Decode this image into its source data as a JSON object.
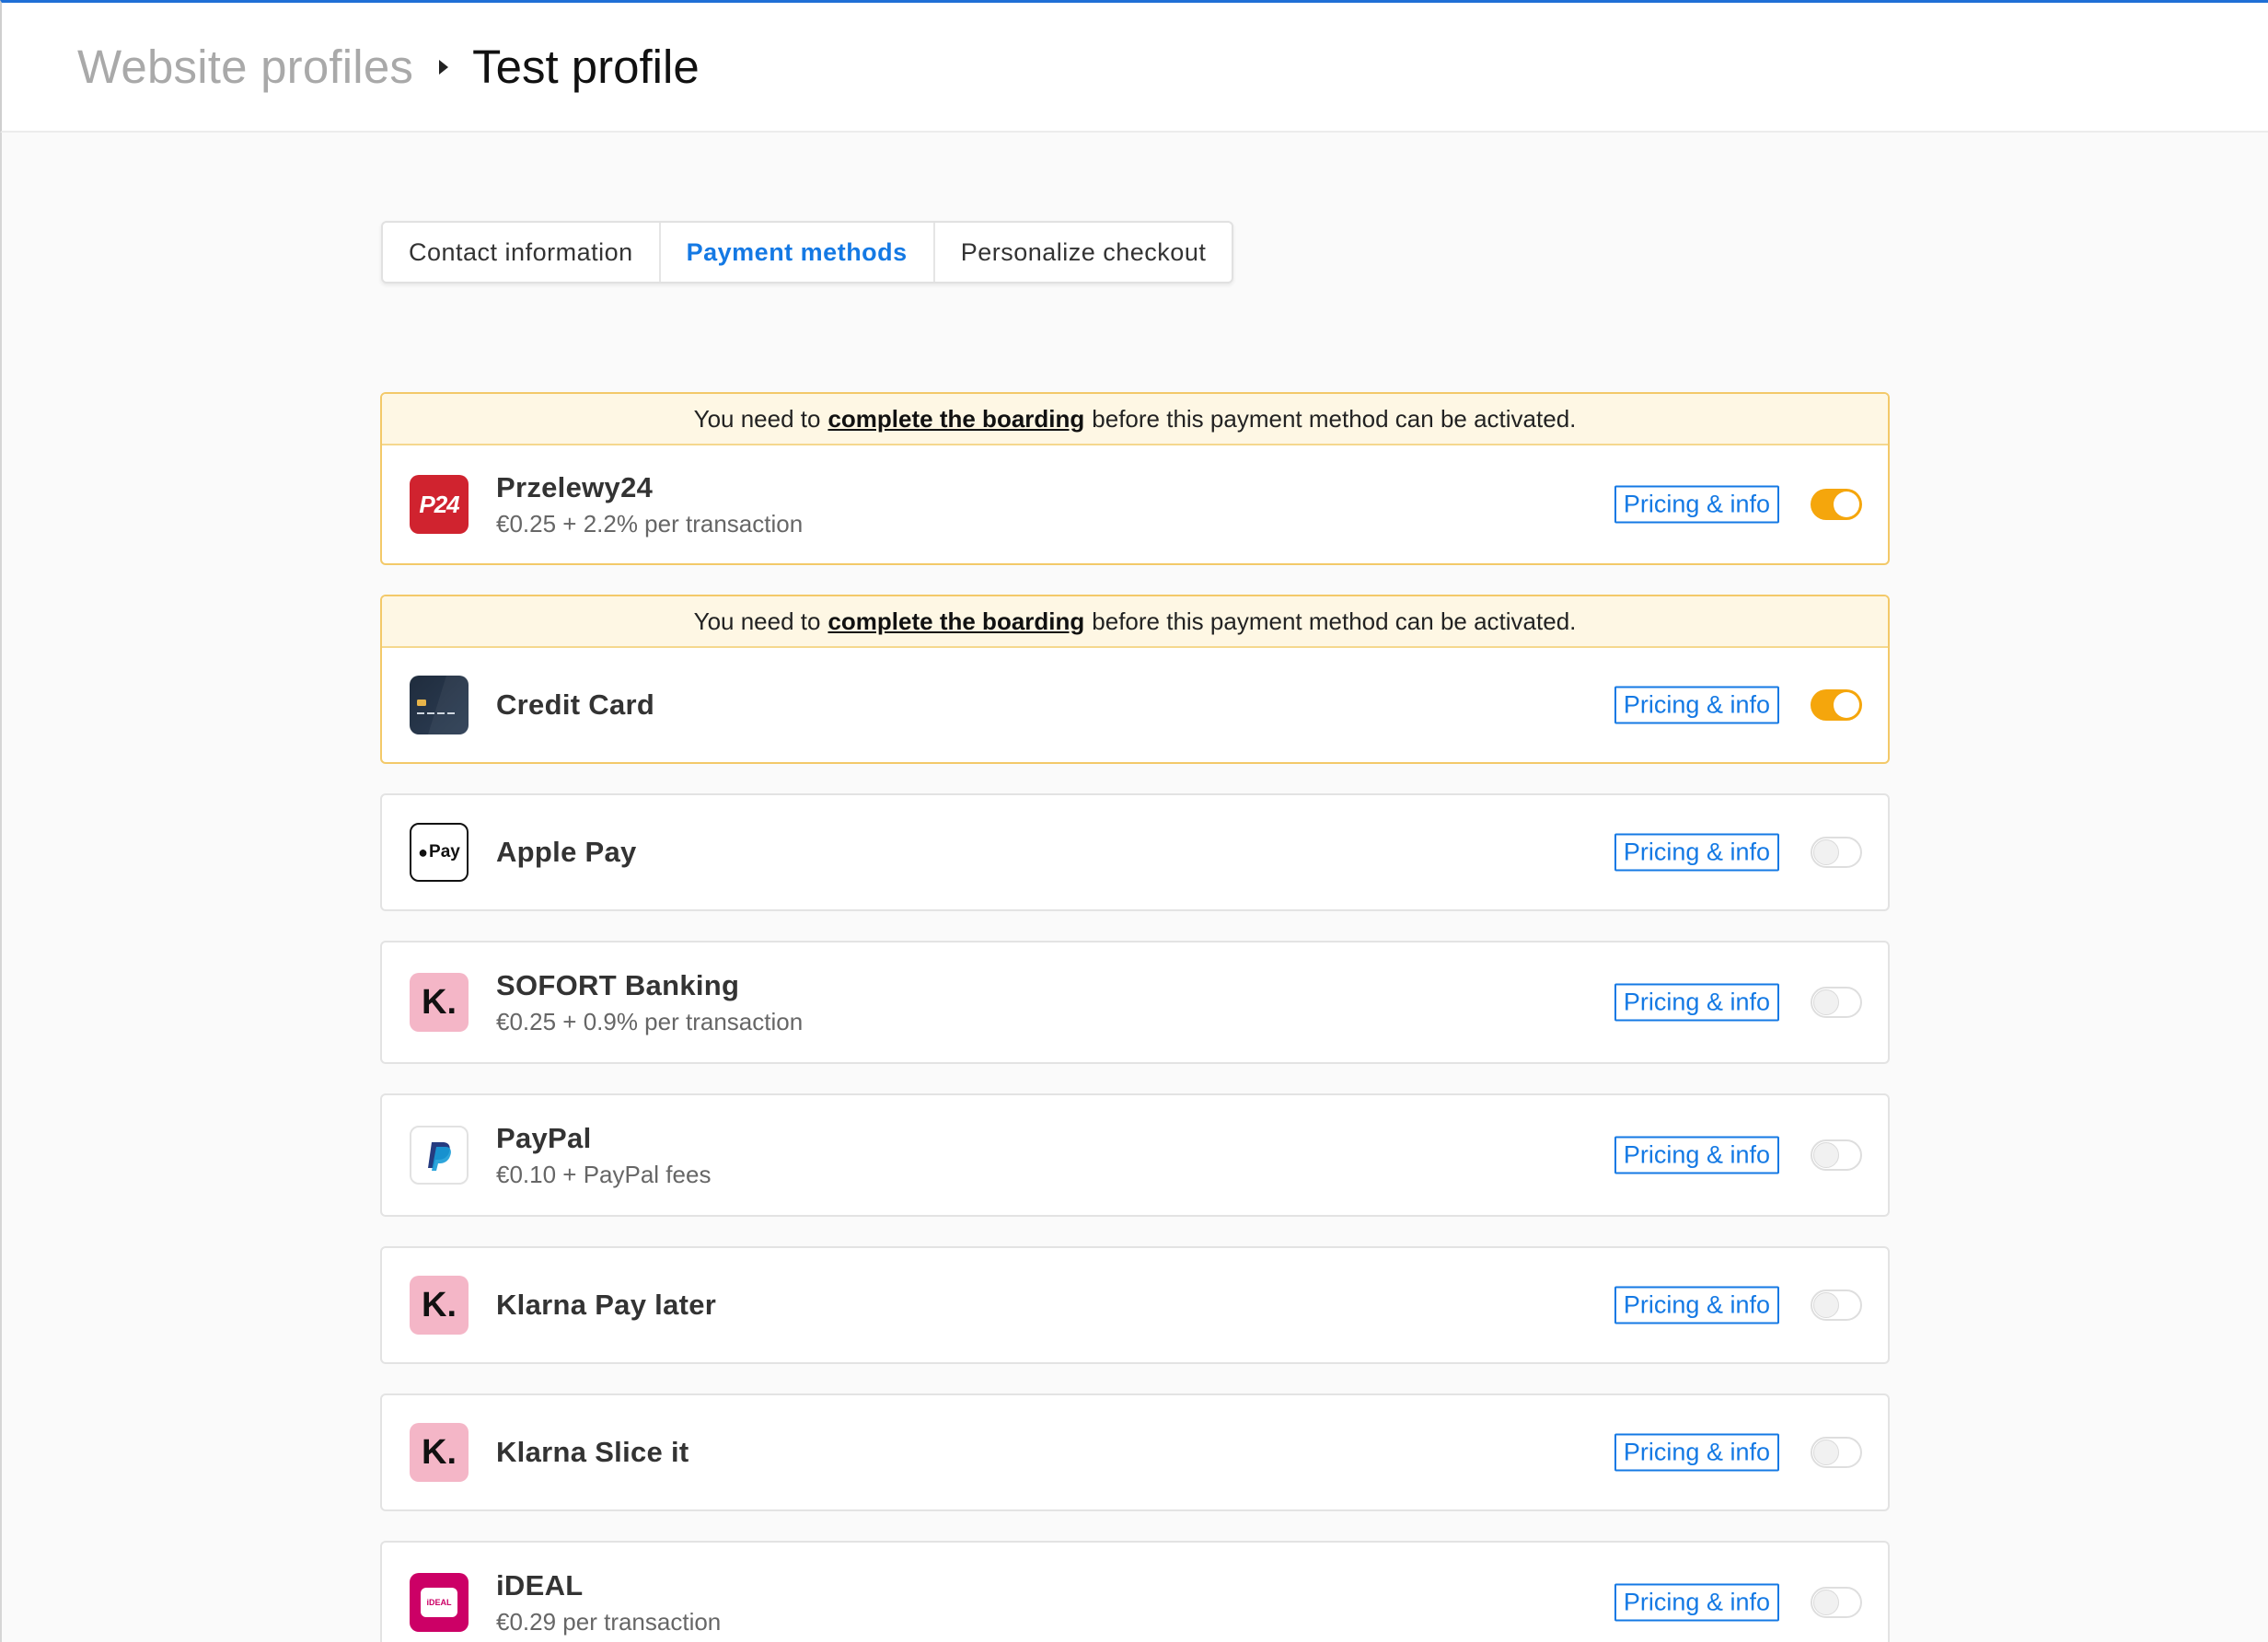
{
  "breadcrumb": {
    "parent": "Website profiles",
    "current": "Test profile"
  },
  "tabs": [
    {
      "label": "Contact information",
      "active": false
    },
    {
      "label": "Payment methods",
      "active": true
    },
    {
      "label": "Personalize checkout",
      "active": false
    }
  ],
  "notice": {
    "prefix": "You need to",
    "link": "complete the boarding",
    "suffix": "before this payment method can be activated."
  },
  "pricing_label": "Pricing & info",
  "colors": {
    "accent": "#1479e4",
    "toggle_on": "#f5a60c",
    "notice_bg": "#fef7e4"
  },
  "methods": [
    {
      "name": "Przelewy24",
      "fee": "€0.25 + 2.2% per transaction",
      "enabled": true,
      "notice": true,
      "icon": "p24-logo-icon",
      "logo_text": "P24"
    },
    {
      "name": "Credit Card",
      "fee": "",
      "enabled": true,
      "notice": true,
      "icon": "credit-card-icon"
    },
    {
      "name": "Apple Pay",
      "fee": "",
      "enabled": false,
      "notice": false,
      "icon": "apple-pay-icon",
      "logo_text": "Pay"
    },
    {
      "name": "SOFORT Banking",
      "fee": "€0.25 + 0.9% per transaction",
      "enabled": false,
      "notice": false,
      "icon": "klarna-icon",
      "logo_text": "K."
    },
    {
      "name": "PayPal",
      "fee": "€0.10 + PayPal fees",
      "enabled": false,
      "notice": false,
      "icon": "paypal-icon"
    },
    {
      "name": "Klarna Pay later",
      "fee": "",
      "enabled": false,
      "notice": false,
      "icon": "klarna-icon",
      "logo_text": "K."
    },
    {
      "name": "Klarna Slice it",
      "fee": "",
      "enabled": false,
      "notice": false,
      "icon": "klarna-icon",
      "logo_text": "K."
    },
    {
      "name": "iDEAL",
      "fee": "€0.29 per transaction",
      "enabled": false,
      "notice": false,
      "icon": "ideal-icon",
      "logo_text": "iDEAL"
    }
  ]
}
